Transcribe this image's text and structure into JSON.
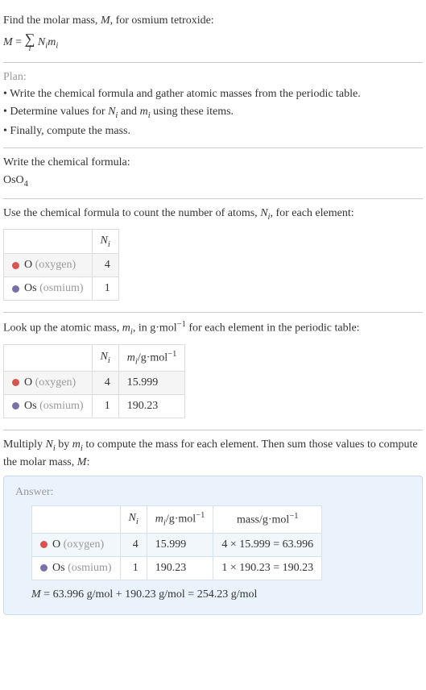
{
  "intro": {
    "line1a": "Find the molar mass, ",
    "line1b": "M",
    "line1c": ", for osmium tetroxide:",
    "eq_lhs": "M",
    "eq_eq": " = ",
    "eq_sum_idx": "i",
    "eq_N": "N",
    "eq_i1": "i",
    "eq_m": "m",
    "eq_i2": "i"
  },
  "plan": {
    "heading": "Plan:",
    "bullet1": "• Write the chemical formula and gather atomic masses from the periodic table.",
    "bullet2a": "• Determine values for ",
    "bullet2_N": "N",
    "bullet2_i1": "i",
    "bullet2_and": " and ",
    "bullet2_m": "m",
    "bullet2_i2": "i",
    "bullet2b": " using these items.",
    "bullet3": "• Finally, compute the mass."
  },
  "formula_section": {
    "line": "Write the chemical formula:",
    "formula_base": "OsO",
    "formula_sub": "4"
  },
  "count_section": {
    "line1": "Use the chemical formula to count the number of atoms, ",
    "Ni_N": "N",
    "Ni_i": "i",
    "line2": ", for each element:",
    "table": {
      "header_blank": "",
      "header_Ni_N": "N",
      "header_Ni_i": "i",
      "rows": [
        {
          "sym": "O",
          "name": " (oxygen)",
          "n": "4",
          "dot": "red"
        },
        {
          "sym": "Os",
          "name": " (osmium)",
          "n": "1",
          "dot": "purple"
        }
      ]
    }
  },
  "mass_section": {
    "line1": "Look up the atomic mass, ",
    "mi_m": "m",
    "mi_i": "i",
    "line2": ", in g·mol",
    "line2_sup": "−1",
    "line3": " for each element in the periodic table:",
    "table": {
      "header_Ni_N": "N",
      "header_Ni_i": "i",
      "header_mi_m": "m",
      "header_mi_i": "i",
      "header_unit": "/g·mol",
      "header_unit_sup": "−1",
      "rows": [
        {
          "sym": "O",
          "name": " (oxygen)",
          "n": "4",
          "m": "15.999",
          "dot": "red"
        },
        {
          "sym": "Os",
          "name": " (osmium)",
          "n": "1",
          "m": "190.23",
          "dot": "purple"
        }
      ]
    }
  },
  "compute_section": {
    "line1a": "Multiply ",
    "N": "N",
    "i1": "i",
    "line1b": " by ",
    "m": "m",
    "i2": "i",
    "line1c": " to compute the mass for each element. Then sum those values to compute the molar mass, ",
    "M": "M",
    "line1d": ":"
  },
  "answer": {
    "label": "Answer:",
    "table": {
      "header_Ni_N": "N",
      "header_Ni_i": "i",
      "header_mi_m": "m",
      "header_mi_i": "i",
      "header_unit": "/g·mol",
      "header_unit_sup": "−1",
      "header_mass": "mass/g·mol",
      "header_mass_sup": "−1",
      "rows": [
        {
          "sym": "O",
          "name": " (oxygen)",
          "n": "4",
          "m": "15.999",
          "mass": "4 × 15.999 = 63.996",
          "dot": "red"
        },
        {
          "sym": "Os",
          "name": " (osmium)",
          "n": "1",
          "m": "190.23",
          "mass": "1 × 190.23 = 190.23",
          "dot": "purple"
        }
      ]
    },
    "eq_M": "M",
    "eq_rest": " = 63.996 g/mol + 190.23 g/mol = 254.23 g/mol"
  },
  "chart_data": {
    "type": "table",
    "title": "Molar mass calculation for osmium tetroxide (OsO4)",
    "elements": [
      {
        "element": "O (oxygen)",
        "N_i": 4,
        "m_i_g_per_mol": 15.999,
        "mass_g_per_mol": 63.996
      },
      {
        "element": "Os (osmium)",
        "N_i": 1,
        "m_i_g_per_mol": 190.23,
        "mass_g_per_mol": 190.23
      }
    ],
    "molar_mass_g_per_mol": 254.23
  }
}
